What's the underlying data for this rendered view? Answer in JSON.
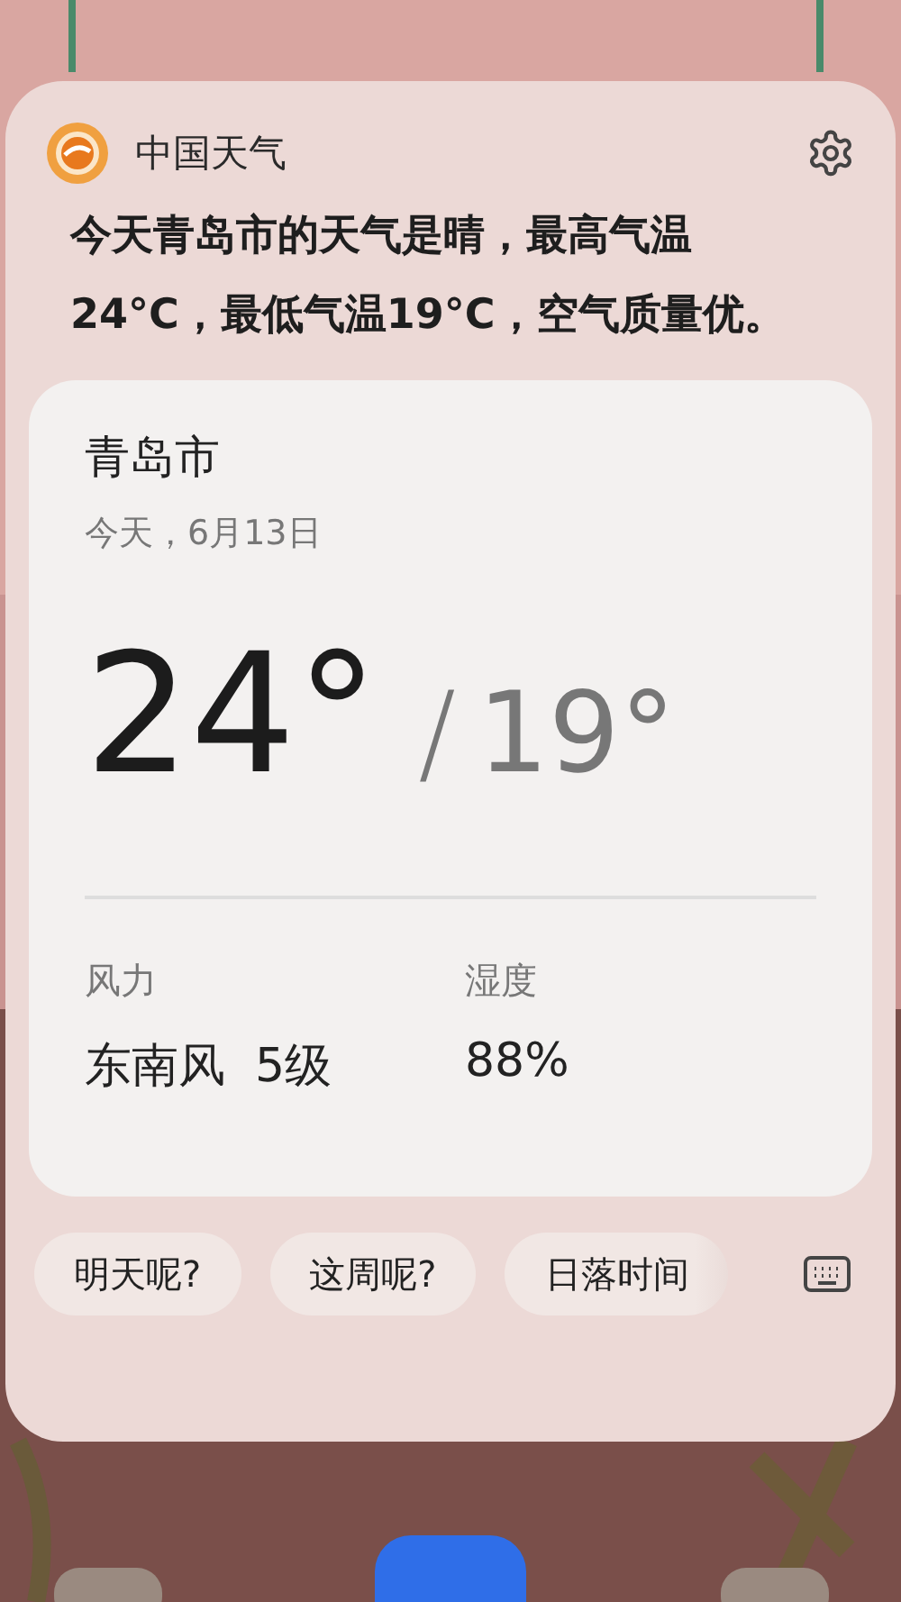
{
  "app": {
    "name": "中国天气"
  },
  "summary": "今天青岛市的天气是晴，最高气温24°C，最低气温19°C，空气质量优。",
  "weather_card": {
    "city": "青岛市",
    "date": "今天，6月13日",
    "high": "24°",
    "separator": "/",
    "low": "19°",
    "details": [
      {
        "label": "风力",
        "value": "东南风  5级"
      },
      {
        "label": "湿度",
        "value": "88%"
      }
    ]
  },
  "suggestions": [
    "明天呢?",
    "这周呢?",
    "日落时间"
  ]
}
